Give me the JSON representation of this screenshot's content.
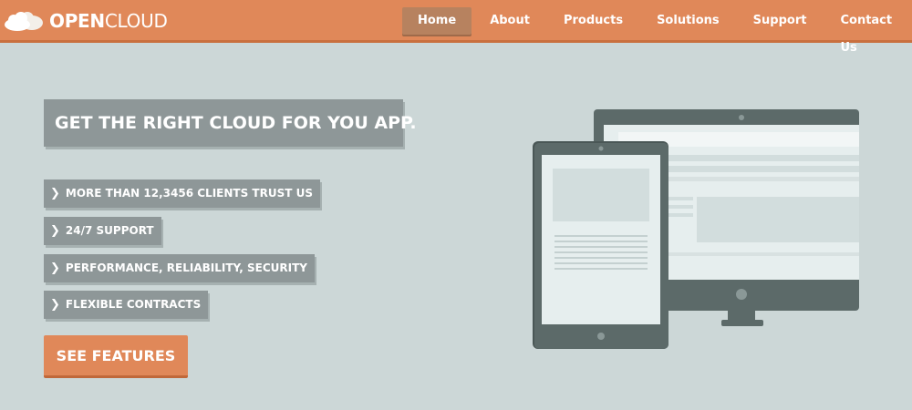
{
  "brand": {
    "name_bold": "OPEN",
    "name_light": "CLOUD",
    "logo_icon": "cloud-icon"
  },
  "nav": {
    "items": [
      {
        "label": "Home",
        "active": true
      },
      {
        "label": "About",
        "active": false
      },
      {
        "label": "Products",
        "active": false
      },
      {
        "label": "Solutions",
        "active": false
      },
      {
        "label": "Support",
        "active": false
      },
      {
        "label": "Contact Us",
        "active": false
      }
    ]
  },
  "hero": {
    "headline": "GET THE RIGHT CLOUD FOR YOU APP.",
    "features": [
      "MORE THAN 12,3456 CLIENTS TRUST US",
      "24/7 SUPPORT",
      "PERFORMANCE, RELIABILITY, SECURITY",
      "FLEXIBLE CONTRACTS"
    ],
    "feature_icon": "chevron-right-icon",
    "cta_label": "SEE FEATURES",
    "illustration": "devices-illustration"
  },
  "colors": {
    "accent": "#e08859",
    "background": "#ccd7d7",
    "tag": "#8e9798",
    "device": "#5c6a69"
  }
}
